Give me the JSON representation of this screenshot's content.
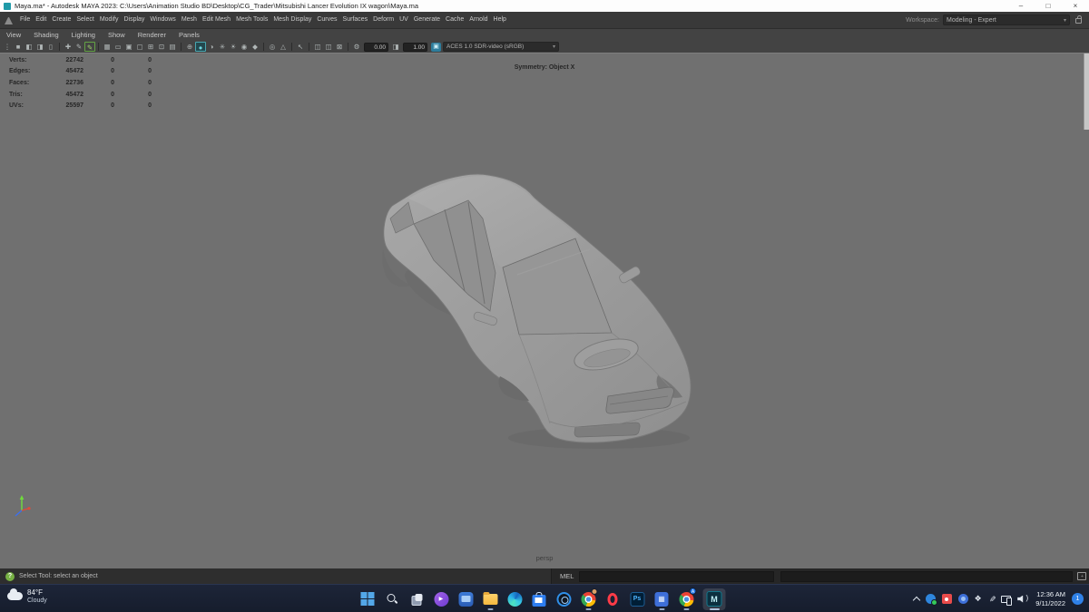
{
  "window": {
    "title": "Maya.ma* - Autodesk MAYA 2023: C:\\Users\\Animation Studio BD\\Desktop\\CG_Trader\\Mitsubishi Lancer Evolution IX wagon\\Maya.ma",
    "controls": {
      "minimize": "–",
      "maximize": "□",
      "close": "×"
    }
  },
  "menu_bar": {
    "items": [
      "File",
      "Edit",
      "Create",
      "Select",
      "Modify",
      "Display",
      "Windows",
      "Mesh",
      "Edit Mesh",
      "Mesh Tools",
      "Mesh Display",
      "Curves",
      "Surfaces",
      "Deform",
      "UV",
      "Generate",
      "Cache",
      "Arnold",
      "Help"
    ],
    "workspace_label": "Workspace:",
    "workspace_value": "Modeling - Expert"
  },
  "panel_menu": {
    "items": [
      "View",
      "Shading",
      "Lighting",
      "Show",
      "Renderer",
      "Panels"
    ]
  },
  "toolbar": {
    "icons": [
      {
        "name": "grip",
        "glyph": "⋮"
      },
      {
        "name": "view-cube",
        "glyph": "■"
      },
      {
        "name": "prev-view",
        "glyph": "◧"
      },
      {
        "name": "next-view",
        "glyph": "◨"
      },
      {
        "name": "bookmark",
        "glyph": "▯"
      },
      {
        "name": "select-by",
        "glyph": "✚"
      },
      {
        "name": "pencil",
        "glyph": "✎"
      },
      {
        "name": "pencil-active",
        "glyph": "✎"
      },
      {
        "name": "grid",
        "glyph": "▦"
      },
      {
        "name": "film-gate",
        "glyph": "▭"
      },
      {
        "name": "resolution-gate",
        "glyph": "▣"
      },
      {
        "name": "gate-mask",
        "glyph": "▢"
      },
      {
        "name": "field-chart",
        "glyph": "⊞"
      },
      {
        "name": "safe-action",
        "glyph": "⊡"
      },
      {
        "name": "safe-title",
        "glyph": "▤"
      },
      {
        "name": "wireframe",
        "glyph": "⊕"
      },
      {
        "name": "shaded",
        "glyph": "●"
      },
      {
        "name": "textured",
        "glyph": "◑"
      },
      {
        "name": "lights",
        "glyph": "✳"
      },
      {
        "name": "shadows",
        "glyph": "☀"
      },
      {
        "name": "ambient-occlusion",
        "glyph": "◉"
      },
      {
        "name": "anti-alias",
        "glyph": "◆"
      },
      {
        "name": "xray",
        "glyph": "◎"
      },
      {
        "name": "isolate-select",
        "glyph": "△"
      },
      {
        "name": "select-arrow",
        "glyph": "↖"
      },
      {
        "name": "pane-single",
        "glyph": "◫"
      },
      {
        "name": "pane-double",
        "glyph": "◫"
      },
      {
        "name": "pane-quad",
        "glyph": "⊠"
      },
      {
        "name": "gear",
        "glyph": "⚙"
      },
      {
        "name": "gamma",
        "glyph": "◨"
      },
      {
        "name": "colorspace",
        "glyph": "▣"
      },
      {
        "name": "dropdown-arrow",
        "glyph": "▾"
      }
    ],
    "exposure": "0.00",
    "gamma": "1.00",
    "color_space": "ACES 1.0 SDR-video (sRGB)"
  },
  "viewport": {
    "symmetry": "Symmetry: Object X",
    "camera_label": "persp",
    "hud": {
      "rows": [
        {
          "label": "Verts:",
          "total": "22742",
          "selected": "0",
          "other": "0"
        },
        {
          "label": "Edges:",
          "total": "45472",
          "selected": "0",
          "other": "0"
        },
        {
          "label": "Faces:",
          "total": "22736",
          "selected": "0",
          "other": "0"
        },
        {
          "label": "Tris:",
          "total": "45472",
          "selected": "0",
          "other": "0"
        },
        {
          "label": "UVs:",
          "total": "25597",
          "selected": "0",
          "other": "0"
        }
      ]
    }
  },
  "command_line": {
    "help_glyph": "?",
    "status": "Select Tool: select an object",
    "mel_label": "MEL"
  },
  "taskbar": {
    "weather": {
      "temp": "84°F",
      "condition": "Cloudy"
    },
    "icons": {
      "photoshop_label": "Ps",
      "maya_label": "M",
      "chrome_profile_badge": "A",
      "calculator_glyph": "▦",
      "clipchamp_glyph": "▶",
      "dropbox_glyph": "❖",
      "pen_glyph": "✎"
    },
    "clock": {
      "time": "12:36 AM",
      "date": "9/11/2022"
    },
    "notification_count": "1"
  }
}
